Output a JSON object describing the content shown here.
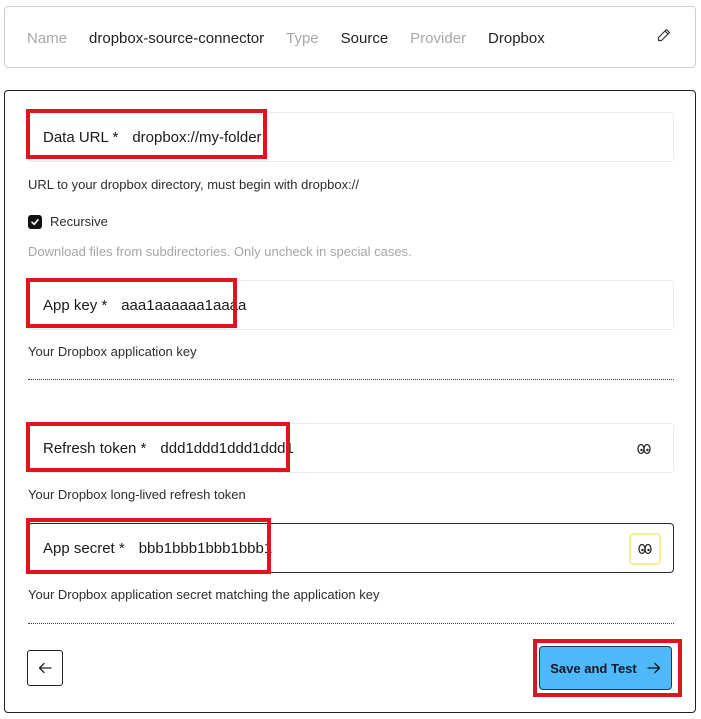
{
  "summary": {
    "name_label": "Name",
    "name_value": "dropbox-source-connector",
    "type_label": "Type",
    "type_value": "Source",
    "provider_label": "Provider",
    "provider_value": "Dropbox",
    "edit_icon": "pencil-icon"
  },
  "form": {
    "data_url": {
      "label": "Data URL *",
      "value": "dropbox://my-folder",
      "helper": "URL to your dropbox directory, must begin with dropbox://"
    },
    "recursive": {
      "label": "Recursive",
      "checked": true,
      "helper": "Download files from subdirectories. Only uncheck in special cases."
    },
    "app_key": {
      "label": "App key *",
      "value": "aaa1aaaaaa1aaaa",
      "helper": "Your Dropbox application key"
    },
    "refresh_token": {
      "label": "Refresh token *",
      "value": "ddd1ddd1ddd1ddd1",
      "helper": "Your Dropbox long-lived refresh token",
      "reveal_icon": "eye-icon"
    },
    "app_secret": {
      "label": "App secret *",
      "value": "bbb1bbb1bbb1bbb1",
      "helper": "Your Dropbox application secret matching the application key",
      "reveal_icon": "eye-icon"
    }
  },
  "actions": {
    "back_icon": "arrow-left-icon",
    "save_label": "Save and Test",
    "save_icon": "arrow-right-icon"
  },
  "colors": {
    "highlight": "#e0141e",
    "primary_button": "#4fb8f8",
    "muted_text": "#a5a5a5"
  }
}
